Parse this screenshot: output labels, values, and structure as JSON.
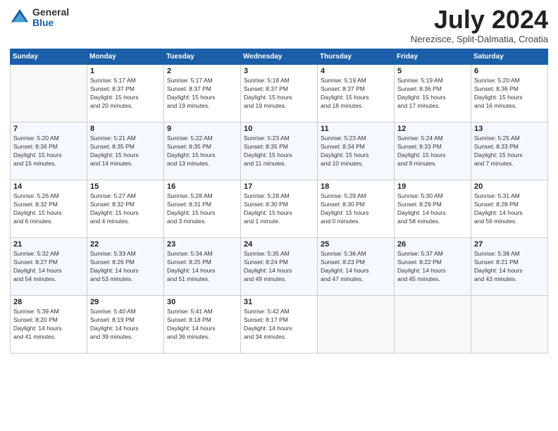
{
  "logo": {
    "general": "General",
    "blue": "Blue"
  },
  "title": "July 2024",
  "location": "Nerezisce, Split-Dalmatia, Croatia",
  "weekdays": [
    "Sunday",
    "Monday",
    "Tuesday",
    "Wednesday",
    "Thursday",
    "Friday",
    "Saturday"
  ],
  "weeks": [
    [
      {
        "day": "",
        "info": ""
      },
      {
        "day": "1",
        "info": "Sunrise: 5:17 AM\nSunset: 8:37 PM\nDaylight: 15 hours\nand 20 minutes."
      },
      {
        "day": "2",
        "info": "Sunrise: 5:17 AM\nSunset: 8:37 PM\nDaylight: 15 hours\nand 19 minutes."
      },
      {
        "day": "3",
        "info": "Sunrise: 5:18 AM\nSunset: 8:37 PM\nDaylight: 15 hours\nand 19 minutes."
      },
      {
        "day": "4",
        "info": "Sunrise: 5:19 AM\nSunset: 8:37 PM\nDaylight: 15 hours\nand 18 minutes."
      },
      {
        "day": "5",
        "info": "Sunrise: 5:19 AM\nSunset: 8:36 PM\nDaylight: 15 hours\nand 17 minutes."
      },
      {
        "day": "6",
        "info": "Sunrise: 5:20 AM\nSunset: 8:36 PM\nDaylight: 15 hours\nand 16 minutes."
      }
    ],
    [
      {
        "day": "7",
        "info": "Sunrise: 5:20 AM\nSunset: 8:36 PM\nDaylight: 15 hours\nand 15 minutes."
      },
      {
        "day": "8",
        "info": "Sunrise: 5:21 AM\nSunset: 8:35 PM\nDaylight: 15 hours\nand 14 minutes."
      },
      {
        "day": "9",
        "info": "Sunrise: 5:22 AM\nSunset: 8:35 PM\nDaylight: 15 hours\nand 13 minutes."
      },
      {
        "day": "10",
        "info": "Sunrise: 5:23 AM\nSunset: 8:35 PM\nDaylight: 15 hours\nand 11 minutes."
      },
      {
        "day": "11",
        "info": "Sunrise: 5:23 AM\nSunset: 8:34 PM\nDaylight: 15 hours\nand 10 minutes."
      },
      {
        "day": "12",
        "info": "Sunrise: 5:24 AM\nSunset: 8:33 PM\nDaylight: 15 hours\nand 9 minutes."
      },
      {
        "day": "13",
        "info": "Sunrise: 5:25 AM\nSunset: 8:33 PM\nDaylight: 15 hours\nand 7 minutes."
      }
    ],
    [
      {
        "day": "14",
        "info": "Sunrise: 5:26 AM\nSunset: 8:32 PM\nDaylight: 15 hours\nand 6 minutes."
      },
      {
        "day": "15",
        "info": "Sunrise: 5:27 AM\nSunset: 8:32 PM\nDaylight: 15 hours\nand 4 minutes."
      },
      {
        "day": "16",
        "info": "Sunrise: 5:28 AM\nSunset: 8:31 PM\nDaylight: 15 hours\nand 3 minutes."
      },
      {
        "day": "17",
        "info": "Sunrise: 5:28 AM\nSunset: 8:30 PM\nDaylight: 15 hours\nand 1 minute."
      },
      {
        "day": "18",
        "info": "Sunrise: 5:29 AM\nSunset: 8:30 PM\nDaylight: 15 hours\nand 0 minutes."
      },
      {
        "day": "19",
        "info": "Sunrise: 5:30 AM\nSunset: 8:29 PM\nDaylight: 14 hours\nand 58 minutes."
      },
      {
        "day": "20",
        "info": "Sunrise: 5:31 AM\nSunset: 8:28 PM\nDaylight: 14 hours\nand 56 minutes."
      }
    ],
    [
      {
        "day": "21",
        "info": "Sunrise: 5:32 AM\nSunset: 8:27 PM\nDaylight: 14 hours\nand 54 minutes."
      },
      {
        "day": "22",
        "info": "Sunrise: 5:33 AM\nSunset: 8:26 PM\nDaylight: 14 hours\nand 53 minutes."
      },
      {
        "day": "23",
        "info": "Sunrise: 5:34 AM\nSunset: 8:25 PM\nDaylight: 14 hours\nand 51 minutes."
      },
      {
        "day": "24",
        "info": "Sunrise: 5:35 AM\nSunset: 8:24 PM\nDaylight: 14 hours\nand 49 minutes."
      },
      {
        "day": "25",
        "info": "Sunrise: 5:36 AM\nSunset: 8:23 PM\nDaylight: 14 hours\nand 47 minutes."
      },
      {
        "day": "26",
        "info": "Sunrise: 5:37 AM\nSunset: 8:22 PM\nDaylight: 14 hours\nand 45 minutes."
      },
      {
        "day": "27",
        "info": "Sunrise: 5:38 AM\nSunset: 8:21 PM\nDaylight: 14 hours\nand 43 minutes."
      }
    ],
    [
      {
        "day": "28",
        "info": "Sunrise: 5:39 AM\nSunset: 8:20 PM\nDaylight: 14 hours\nand 41 minutes."
      },
      {
        "day": "29",
        "info": "Sunrise: 5:40 AM\nSunset: 8:19 PM\nDaylight: 14 hours\nand 39 minutes."
      },
      {
        "day": "30",
        "info": "Sunrise: 5:41 AM\nSunset: 8:18 PM\nDaylight: 14 hours\nand 36 minutes."
      },
      {
        "day": "31",
        "info": "Sunrise: 5:42 AM\nSunset: 8:17 PM\nDaylight: 14 hours\nand 34 minutes."
      },
      {
        "day": "",
        "info": ""
      },
      {
        "day": "",
        "info": ""
      },
      {
        "day": "",
        "info": ""
      }
    ]
  ]
}
